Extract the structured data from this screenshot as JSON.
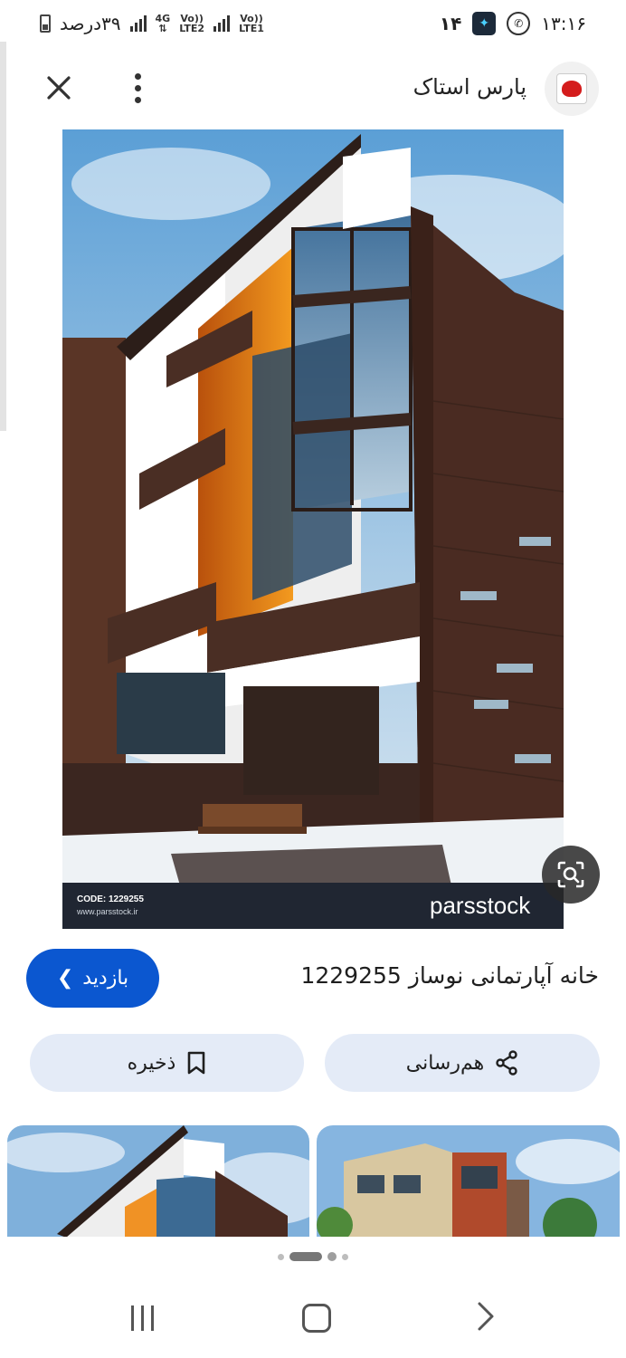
{
  "status_bar": {
    "battery_text": "۳۹درصد",
    "net1": "4G",
    "net2_top": "Vo))",
    "net2_bottom": "LTE2",
    "net3_top": "Vo))",
    "net3_bottom": "LTE1",
    "notif_count": "۱۴",
    "time": "۱۳:۱۶"
  },
  "header": {
    "site_name": "پارس استاک"
  },
  "hero": {
    "code_text": "CODE: 1229255",
    "url_text": "www.parsstock.ir",
    "watermark": "parsstock"
  },
  "result": {
    "title": "خانه آپارتمانی نوساز 1229255",
    "visit_label": "بازدید"
  },
  "actions": {
    "share_label": "هم‌رسانی",
    "save_label": "ذخیره"
  },
  "carousel": {
    "active_index": 1,
    "total_dots": 4
  },
  "colors": {
    "accent": "#0b57d0",
    "pill_bg": "#e4ebf7",
    "building_brown": "#4a2e24"
  }
}
